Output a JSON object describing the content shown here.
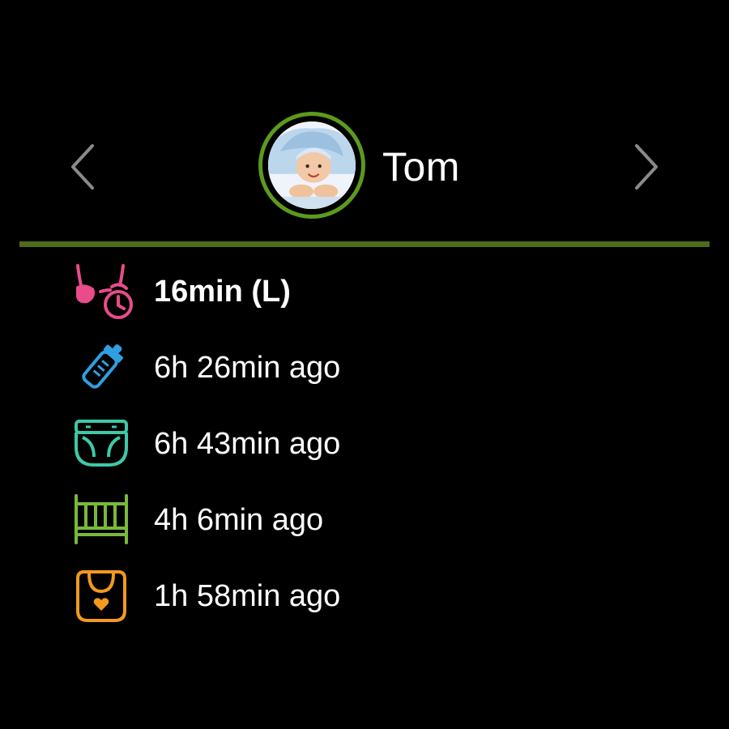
{
  "header": {
    "prev_icon": "chevron-left-icon",
    "next_icon": "chevron-right-icon",
    "child_name": "Tom",
    "avatar": "baby-photo",
    "ring_color": "#5c9a1f",
    "divider_color": "#4d6b1a"
  },
  "activities": [
    {
      "type": "breastfeeding",
      "icon": "breastfeeding-timer-icon",
      "color": "#e84c8a",
      "text": "16min (L)",
      "bold": true
    },
    {
      "type": "bottle",
      "icon": "baby-bottle-icon",
      "color": "#2f9fe0",
      "text": "6h 26min ago",
      "bold": false
    },
    {
      "type": "diaper",
      "icon": "diaper-icon",
      "color": "#3ec9a8",
      "text": "6h 43min ago",
      "bold": false
    },
    {
      "type": "sleep",
      "icon": "crib-icon",
      "color": "#7ab83a",
      "text": "4h 6min ago",
      "bold": false
    },
    {
      "type": "solids",
      "icon": "bib-icon",
      "color": "#f29a1c",
      "text": "1h 58min ago",
      "bold": false
    }
  ]
}
